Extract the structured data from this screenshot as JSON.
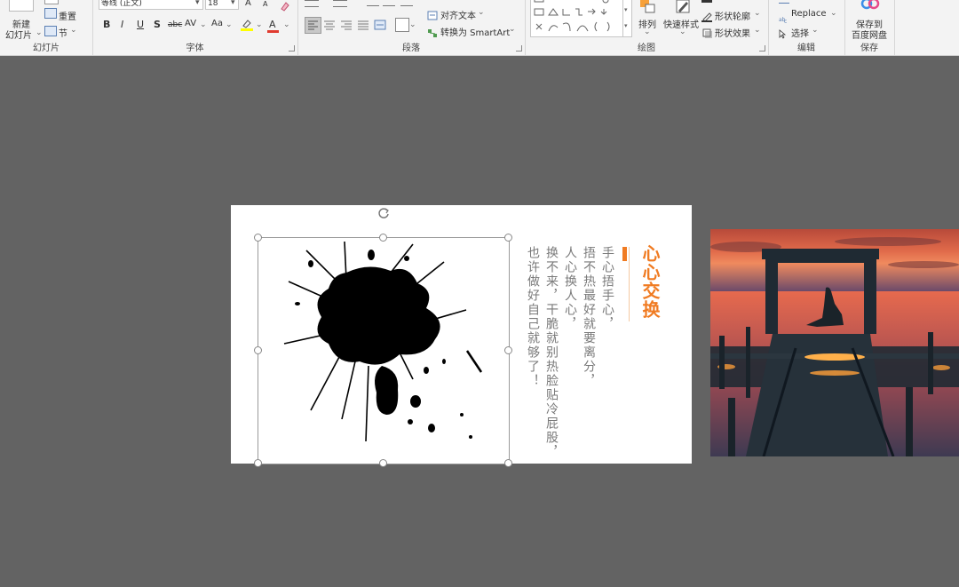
{
  "ribbon": {
    "slides": {
      "new_slide": "新建\n幻灯片",
      "new_slide_line1": "新建",
      "new_slide_line2": "幻灯片",
      "reset": "重置",
      "section": "节",
      "group_label": "幻灯片"
    },
    "font": {
      "font_name": "等线 (正文)",
      "font_size": "18",
      "bold": "B",
      "italic": "I",
      "underline": "U",
      "shadow": "S",
      "strike": "abc",
      "spacing": "AV",
      "case": "Aa",
      "grow": "A",
      "shrink": "A",
      "font_color": "A",
      "group_label": "字体"
    },
    "paragraph": {
      "align_text": "对齐文本",
      "convert_smartart": "转换为 SmartArt",
      "group_label": "段落"
    },
    "drawing": {
      "arrange": "排列",
      "quick_styles": "快速样式",
      "shape_outline": "形状轮廓",
      "shape_effects": "形状效果",
      "group_label": "绘图"
    },
    "editing": {
      "replace": "Replace",
      "select": "选择",
      "group_label": "编辑"
    },
    "save": {
      "save_line1": "保存到",
      "save_line2": "百度网盘",
      "group_label": "保存"
    }
  },
  "slide": {
    "title": "心心交换",
    "lines": [
      "手心捂手心，",
      "捂不热最好就要离分，",
      "人心换人心，",
      "换不来，干脆就别热脸贴冷屁股，",
      "也许做好自己就够了！"
    ]
  },
  "colors": {
    "accent": "#f07b22",
    "canvas": "#636363",
    "ribbon": "#f3f3f3"
  }
}
